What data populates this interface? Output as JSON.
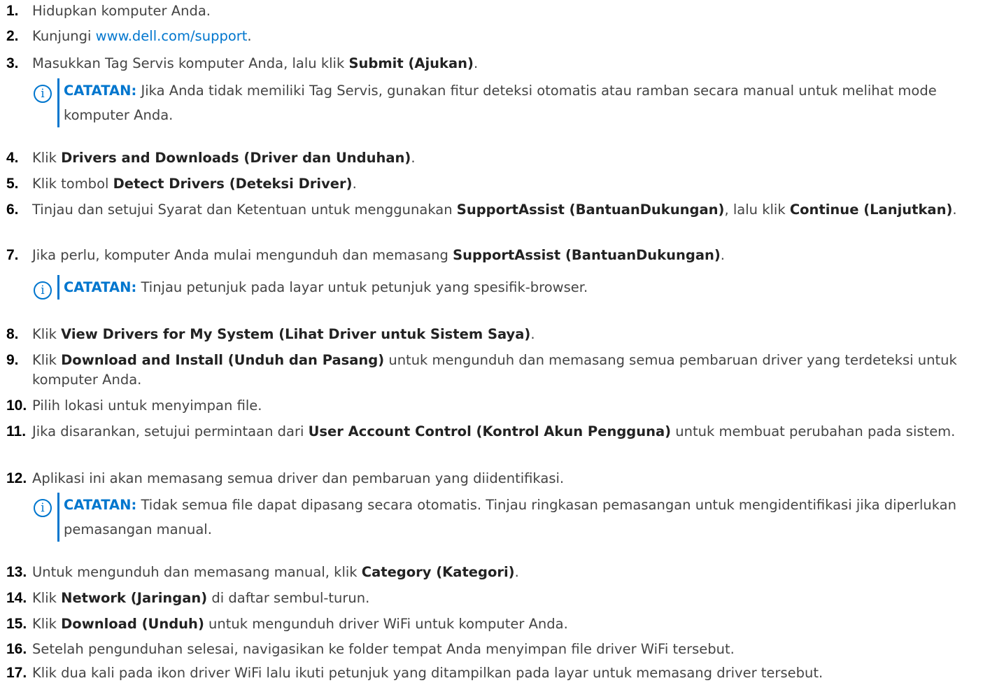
{
  "steps": [
    {
      "num": "1.",
      "parts": [
        "Hidupkan komputer Anda."
      ]
    },
    {
      "num": "2.",
      "pre": "Kunjungi ",
      "link": "www.dell.com/support",
      "post": "."
    },
    {
      "num": "3.",
      "pre": "Masukkan Tag Servis komputer Anda, lalu klik ",
      "bold": "Submit (Ajukan)",
      "post": "."
    },
    {
      "num": "4.",
      "pre": "Klik ",
      "bold": "Drivers and Downloads (Driver dan Unduhan)",
      "post": "."
    },
    {
      "num": "5.",
      "pre": "Klik tombol ",
      "bold": "Detect Drivers (Deteksi Driver)",
      "post": "."
    },
    {
      "num": "6.",
      "pre": "Tinjau dan setujui Syarat dan Ketentuan untuk menggunakan ",
      "bold": "SupportAssist (BantuanDukungan)",
      "mid": ", lalu klik ",
      "bold2": "Continue (Lanjutkan)",
      "post": "."
    },
    {
      "num": "7.",
      "pre": "Jika perlu, komputer Anda mulai mengunduh dan memasang ",
      "bold": "SupportAssist (BantuanDukungan)",
      "post": "."
    },
    {
      "num": "8.",
      "pre": "Klik ",
      "bold": "View Drivers for My System (Lihat Driver untuk Sistem Saya)",
      "post": "."
    },
    {
      "num": "9.",
      "pre": "Klik ",
      "bold": "Download and Install (Unduh dan Pasang)",
      "post": " untuk mengunduh dan memasang semua pembaruan driver yang terdeteksi untuk komputer Anda."
    },
    {
      "num": "10.",
      "parts": [
        "Pilih lokasi untuk menyimpan file."
      ]
    },
    {
      "num": "11.",
      "pre": "Jika disarankan, setujui permintaan dari ",
      "bold": "User Account Control (Kontrol Akun Pengguna)",
      "post": " untuk membuat perubahan pada sistem."
    },
    {
      "num": "12.",
      "parts": [
        "Aplikasi ini akan memasang semua driver dan pembaruan yang diidentifikasi."
      ]
    },
    {
      "num": "13.",
      "pre": "Untuk mengunduh dan memasang manual, klik ",
      "bold": "Category (Kategori)",
      "post": "."
    },
    {
      "num": "14.",
      "pre": "Klik ",
      "bold": "Network (Jaringan)",
      "post": " di daftar sembul-turun."
    },
    {
      "num": "15.",
      "pre": "Klik ",
      "bold": "Download (Unduh)",
      "post": " untuk mengunduh driver WiFi untuk komputer Anda."
    },
    {
      "num": "16.",
      "parts": [
        "Setelah pengunduhan selesai, navigasikan ke folder tempat Anda menyimpan file driver WiFi tersebut."
      ]
    },
    {
      "num": "17.",
      "parts": [
        "Klik dua kali pada ikon driver WiFi lalu ikuti petunjuk yang ditampilkan pada layar untuk memasang driver tersebut."
      ]
    }
  ],
  "notes": {
    "label": "CATATAN:",
    "icon": "info-icon",
    "accent": "#0076ce",
    "note1": " Jika Anda tidak memiliki Tag Servis, gunakan fitur deteksi otomatis atau ramban secara manual untuk melihat mode komputer Anda.",
    "note2": " Tinjau petunjuk pada layar untuk petunjuk yang spesifik-browser.",
    "note3": " Tidak semua file dapat dipasang secara otomatis. Tinjau ringkasan pemasangan untuk mengidentifikasi jika diperlukan pemasangan manual."
  }
}
